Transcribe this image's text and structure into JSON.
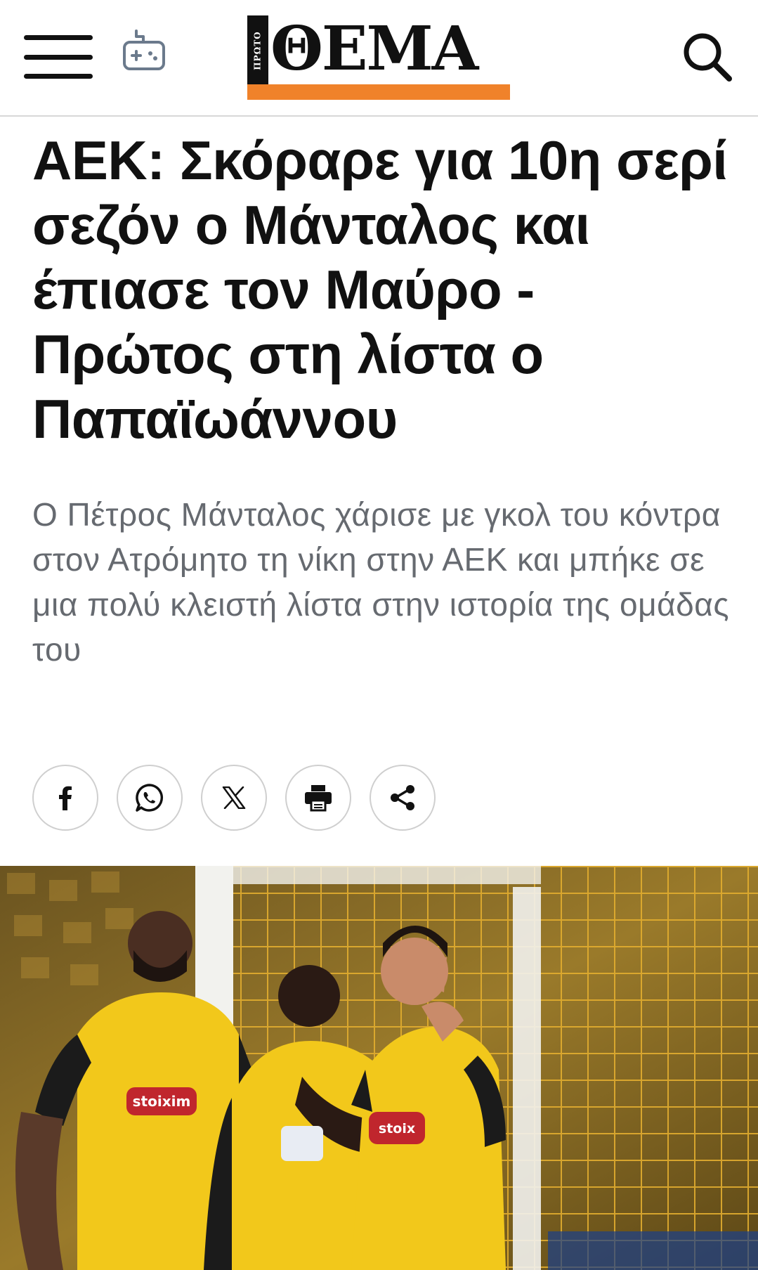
{
  "header": {
    "logo_small": "ΠΡΩΤΟ",
    "logo_word": "ΘΕΜΑ",
    "logo_bar_color": "#f0822a",
    "icons": [
      "menu-icon",
      "gamepad-icon",
      "search-icon"
    ]
  },
  "article": {
    "headline": "ΑΕΚ: Σκόραρε για 10η σερί σεζόν ο Μάνταλος και έπιασε τον Μαύρο - Πρώτος στη λίστα ο Παπαϊωάννου",
    "lead": "Ο Πέτρος Μάνταλος χάρισε με γκολ του κόντρα στον Ατρόμητο τη νίκη στην ΑΕΚ και μπήκε σε μια πολύ κλειστή λίστα στην ιστορία της ομάδας του"
  },
  "share": [
    {
      "icon": "facebook-icon"
    },
    {
      "icon": "whatsapp-icon"
    },
    {
      "icon": "x-icon"
    },
    {
      "icon": "print-icon"
    },
    {
      "icon": "share-icon"
    }
  ],
  "photo": {
    "shirt_sponsor": "stoiximan",
    "colors": {
      "jersey": "#f2c81b",
      "net": "#e6b53a",
      "dark": "#1b1b1b"
    }
  }
}
